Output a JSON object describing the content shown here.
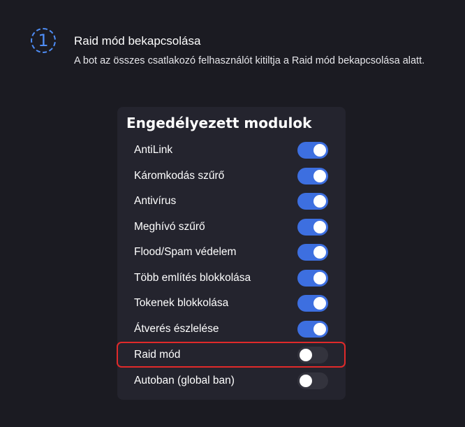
{
  "step": {
    "number": "1",
    "title": "Raid mód bekapcsolása",
    "description": "A bot az összes csatlakozó felhasználót kitiltja a Raid mód bekapcsolása alatt."
  },
  "panel": {
    "title": "Engedélyezett modulok",
    "modules": [
      {
        "label": "AntiLink",
        "enabled": true
      },
      {
        "label": "Káromkodás szűrő",
        "enabled": true
      },
      {
        "label": "Antivírus",
        "enabled": true
      },
      {
        "label": "Meghívó szűrő",
        "enabled": true
      },
      {
        "label": "Flood/Spam védelem",
        "enabled": true
      },
      {
        "label": "Több említés blokkolása",
        "enabled": true
      },
      {
        "label": "Tokenek blokkolása",
        "enabled": true
      },
      {
        "label": "Átverés észlelése",
        "enabled": true
      },
      {
        "label": "Raid mód",
        "enabled": false
      },
      {
        "label": "Autoban (global ban)",
        "enabled": false
      }
    ]
  },
  "colors": {
    "accent": "#4f8ef7",
    "toggle_on": "#3d6fe0",
    "toggle_off": "#33333d",
    "highlight": "#e02a2a",
    "background": "#1b1b22",
    "panel": "#24242e"
  },
  "highlighted_module": "Raid mód"
}
